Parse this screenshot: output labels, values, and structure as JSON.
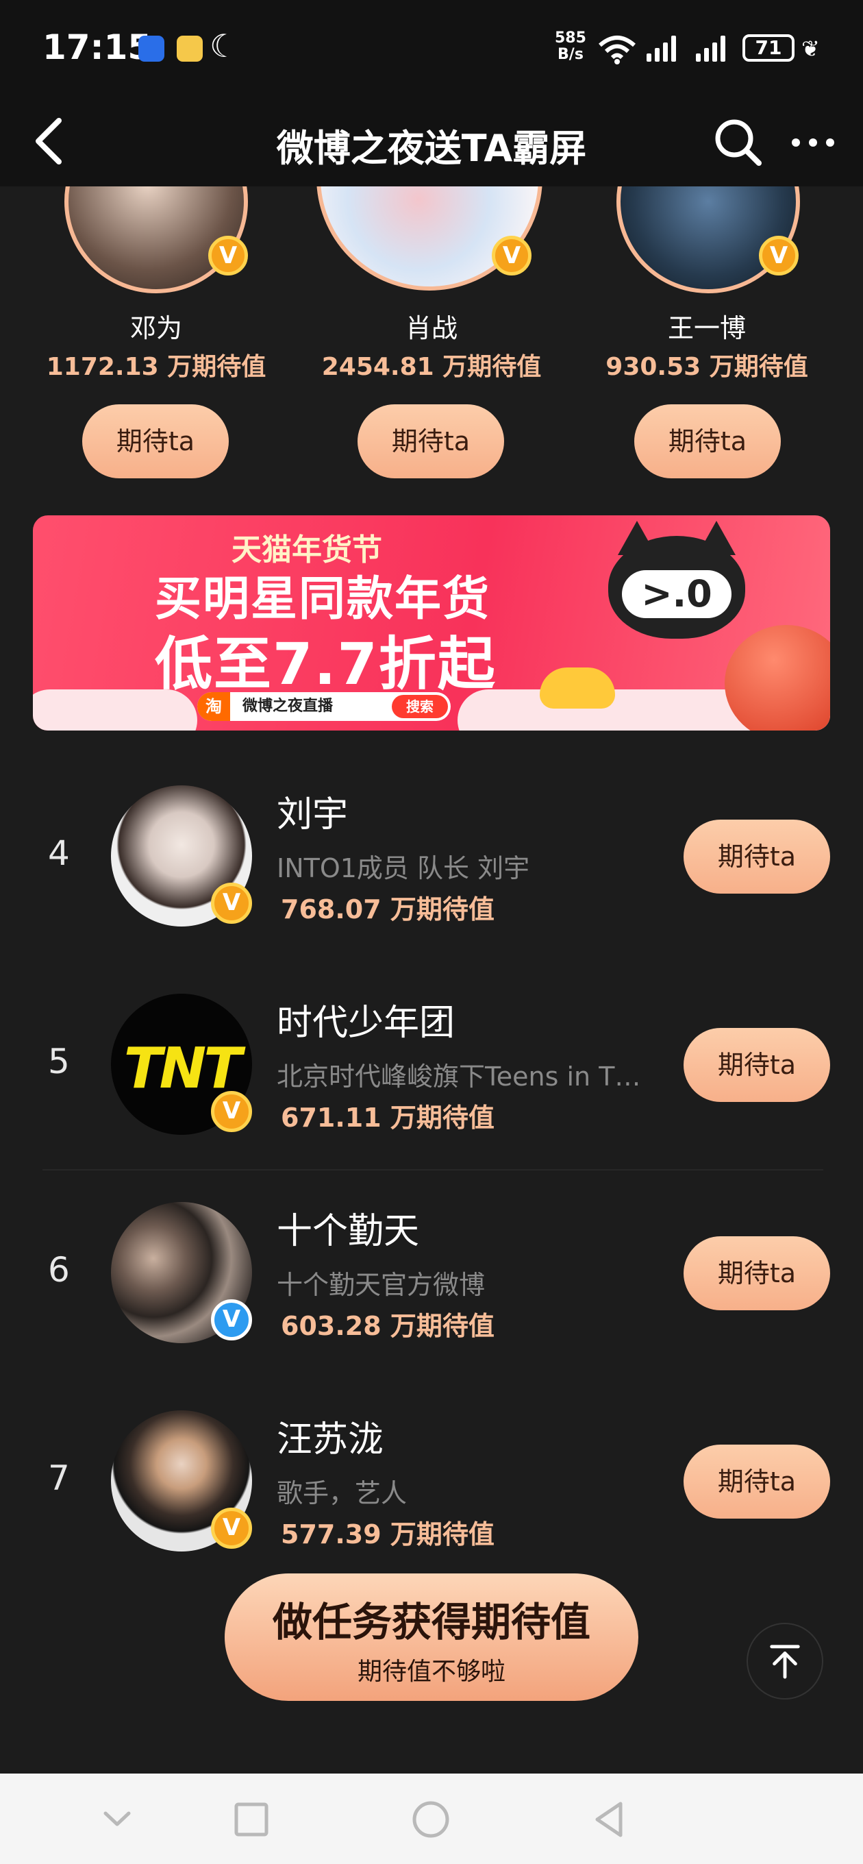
{
  "status_bar": {
    "time": "17:15",
    "net_speed": "585",
    "net_unit": "B/s",
    "network_type": "6",
    "battery": "71"
  },
  "header": {
    "title": "微博之夜送TA霸屏",
    "back_icon": "chevron-left-icon",
    "search_icon": "search-icon",
    "more_icon": "more-icon"
  },
  "podium": [
    {
      "name": "邓为",
      "score": "1172.13 万期待值",
      "button": "期待ta"
    },
    {
      "name": "肖战",
      "score": "2454.81 万期待值",
      "button": "期待ta"
    },
    {
      "name": "王一博",
      "score": "930.53 万期待值",
      "button": "期待ta"
    }
  ],
  "banner": {
    "subtitle": "天猫年货节",
    "line1": "买明星同款年货",
    "line2": "低至7.7折起",
    "tao_icon": "淘",
    "search_text": "微博之夜直播",
    "search_button": "搜索",
    "mascot_face": ">.0"
  },
  "list": [
    {
      "rank": "4",
      "name": "刘宇",
      "desc": "INTO1成员 队长 刘宇",
      "score": "768.07 万期待值",
      "button": "期待ta",
      "verified": "orange"
    },
    {
      "rank": "5",
      "name": "时代少年团",
      "desc": "北京时代峰峻旗下Teens in T…",
      "score": "671.11 万期待值",
      "button": "期待ta",
      "verified": "orange",
      "logo_text": "TNT"
    },
    {
      "rank": "6",
      "name": "十个勤天",
      "desc": "十个勤天官方微博",
      "score": "603.28 万期待值",
      "button": "期待ta",
      "verified": "blue"
    },
    {
      "rank": "7",
      "name": "汪苏泷",
      "desc": "歌手，艺人",
      "score": "577.39 万期待值",
      "button": "期待ta",
      "verified": "orange"
    }
  ],
  "floating": {
    "task_title": "做任务获得期待值",
    "task_subtitle": "期待值不够啦"
  },
  "colors": {
    "background": "#1c1c1c",
    "accent": "#f7bd98",
    "button_gradient_top": "#fccdaa",
    "button_gradient_bottom": "#f7b08a",
    "verified_orange": "#f6a21a",
    "verified_blue": "#2d9bf0",
    "banner_red": "#f8325a"
  }
}
